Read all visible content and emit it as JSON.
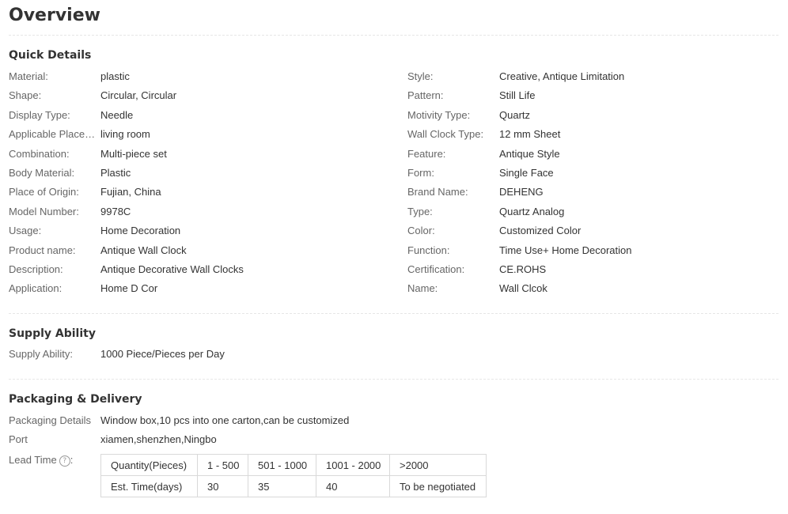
{
  "page_title": "Overview",
  "quick_details": {
    "title": "Quick Details",
    "left": [
      {
        "label": "Material:",
        "value": "plastic"
      },
      {
        "label": "Shape:",
        "value": "Circular, Circular"
      },
      {
        "label": "Display Type:",
        "value": "Needle"
      },
      {
        "label": "Applicable Placem...",
        "value": "living room"
      },
      {
        "label": "Combination:",
        "value": "Multi-piece set"
      },
      {
        "label": "Body Material:",
        "value": "Plastic"
      },
      {
        "label": "Place of Origin:",
        "value": "Fujian, China"
      },
      {
        "label": "Model Number:",
        "value": "9978C"
      },
      {
        "label": "Usage:",
        "value": "Home Decoration"
      },
      {
        "label": "Product name:",
        "value": "Antique Wall Clock"
      },
      {
        "label": "Description:",
        "value": "Antique Decorative Wall Clocks"
      },
      {
        "label": "Application:",
        "value": "Home D Cor"
      }
    ],
    "right": [
      {
        "label": "Style:",
        "value": "Creative, Antique Limitation"
      },
      {
        "label": "Pattern:",
        "value": "Still Life"
      },
      {
        "label": "Motivity Type:",
        "value": "Quartz"
      },
      {
        "label": "Wall Clock Type:",
        "value": "12 mm Sheet"
      },
      {
        "label": "Feature:",
        "value": "Antique Style"
      },
      {
        "label": "Form:",
        "value": "Single Face"
      },
      {
        "label": "Brand Name:",
        "value": "DEHENG"
      },
      {
        "label": "Type:",
        "value": "Quartz Analog"
      },
      {
        "label": "Color:",
        "value": "Customized Color"
      },
      {
        "label": "Function:",
        "value": "Time Use+ Home Decoration"
      },
      {
        "label": "Certification:",
        "value": "CE.ROHS"
      },
      {
        "label": "Name:",
        "value": "Wall Clcok"
      }
    ]
  },
  "supply_ability": {
    "title": "Supply Ability",
    "label": "Supply Ability:",
    "value": "1000 Piece/Pieces per Day"
  },
  "packaging": {
    "title": "Packaging & Delivery",
    "details_label": "Packaging Details",
    "details_value": "Window box,10 pcs into one carton,can be customized",
    "port_label": "Port",
    "port_value": "xiamen,shenzhen,Ningbo",
    "lead_time_label": "Lead Time",
    "help_icon": "?",
    "lead_colon": ":",
    "lead_table": {
      "row1": [
        "Quantity(Pieces)",
        "1 - 500",
        "501 - 1000",
        "1001 - 2000",
        ">2000"
      ],
      "row2": [
        "Est. Time(days)",
        "30",
        "35",
        "40",
        "To be negotiated"
      ]
    }
  }
}
